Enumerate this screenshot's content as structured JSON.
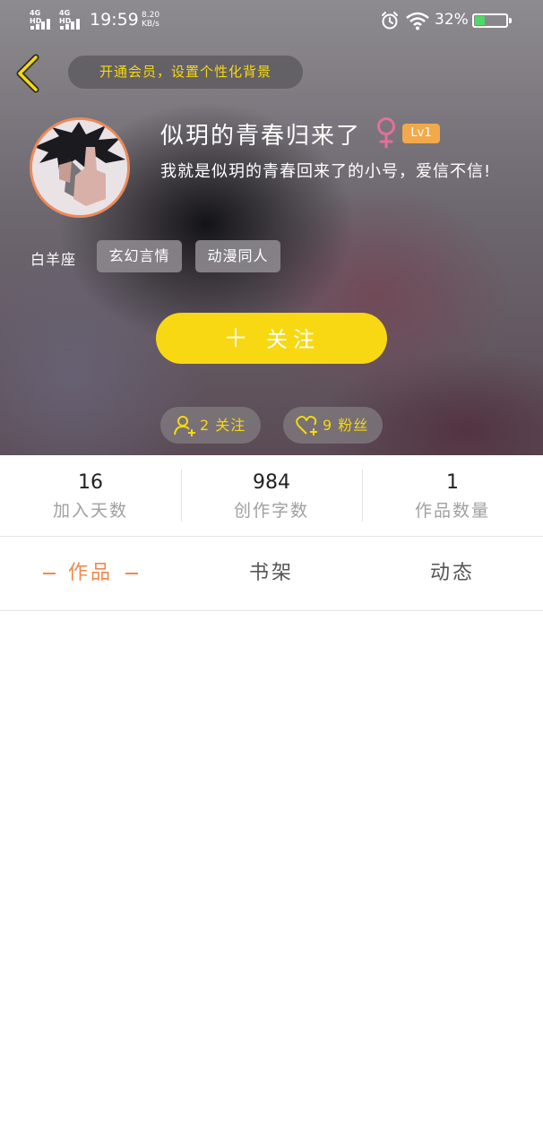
{
  "status_bar": {
    "sim1": "4G HD",
    "sim2": "4G HD",
    "time": "19:59",
    "speed_value": "8.20",
    "speed_unit": "KB/s",
    "battery_percent": "32%",
    "battery_level": 0.32
  },
  "header": {
    "vip_banner": "开通会员，设置个性化背景",
    "username": "似玥的青春归来了",
    "gender_symbol": "♀",
    "level": "Lv1",
    "bio": "我就是似玥的青春回来了的小号，爱信不信!",
    "zodiac": "白羊座",
    "tags": [
      "玄幻言情",
      "动漫同人"
    ],
    "follow_button": "关注",
    "following": "2 关注",
    "fans": "9 粉丝"
  },
  "stats": [
    {
      "value": "16",
      "label": "加入天数"
    },
    {
      "value": "984",
      "label": "创作字数"
    },
    {
      "value": "1",
      "label": "作品数量"
    }
  ],
  "tabs": [
    {
      "label": "作品",
      "active": true
    },
    {
      "label": "书架",
      "active": false
    },
    {
      "label": "动态",
      "active": false
    }
  ],
  "colors": {
    "accent_yellow": "#f7d812",
    "accent_orange": "#ee8a4e",
    "level_badge": "#f1a94b"
  }
}
